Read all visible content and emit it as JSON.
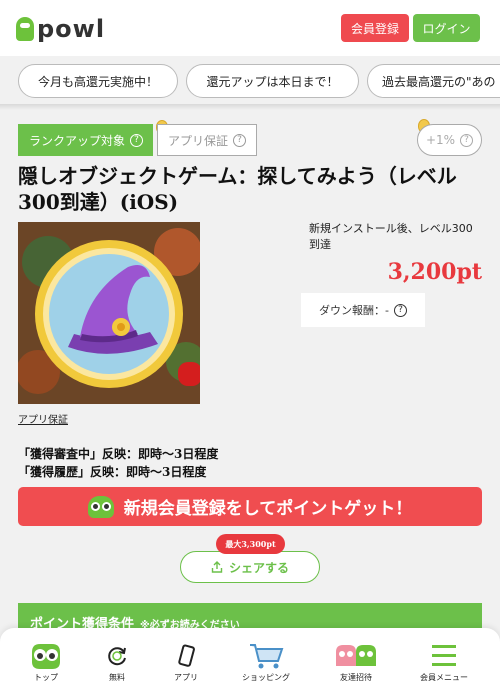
{
  "header": {
    "logo_text": "powl",
    "register_label": "会員登録",
    "login_label": "ログイン"
  },
  "chips": [
    "今月も高還元実施中！",
    "還元アップは本日まで！",
    "過去最高還元の\"あの"
  ],
  "badges": {
    "rankup": "ランクアップ対象",
    "app_guarantee": "アプリ保証",
    "plus_rate": "+1%"
  },
  "offer": {
    "title": "隠しオブジェクトゲーム：探してみよう（レベル300到達）(iOS)",
    "condition": "新規インストール後、レベル300到達",
    "points": "3,200pt",
    "down_reward": "ダウン報酬：-",
    "app_guarantee_link": "アプリ保証",
    "reflect_review": "「獲得審査中」反映：即時～3日程度",
    "reflect_history": "「獲得履歴」反映：即時～3日程度"
  },
  "cta": {
    "label": "新規会員登録をしてポイントゲット！"
  },
  "share": {
    "max_badge": "最大3,300pt",
    "label": "シェアする"
  },
  "conditions_header": {
    "title": "ポイント獲得条件",
    "note": "※必ずお読みください"
  },
  "bottom_nav": [
    {
      "label": "トップ",
      "icon": "owl-icon"
    },
    {
      "label": "無料",
      "icon": "free-coin-icon"
    },
    {
      "label": "アプリ",
      "icon": "smartphone-icon"
    },
    {
      "label": "ショッピング",
      "icon": "cart-icon"
    },
    {
      "label": "友達招待",
      "icon": "friends-icon"
    },
    {
      "label": "会員メニュー",
      "icon": "menu-icon"
    }
  ],
  "colors": {
    "green": "#6cc04a",
    "red": "#ef4a4f",
    "points_red": "#e8393e"
  }
}
